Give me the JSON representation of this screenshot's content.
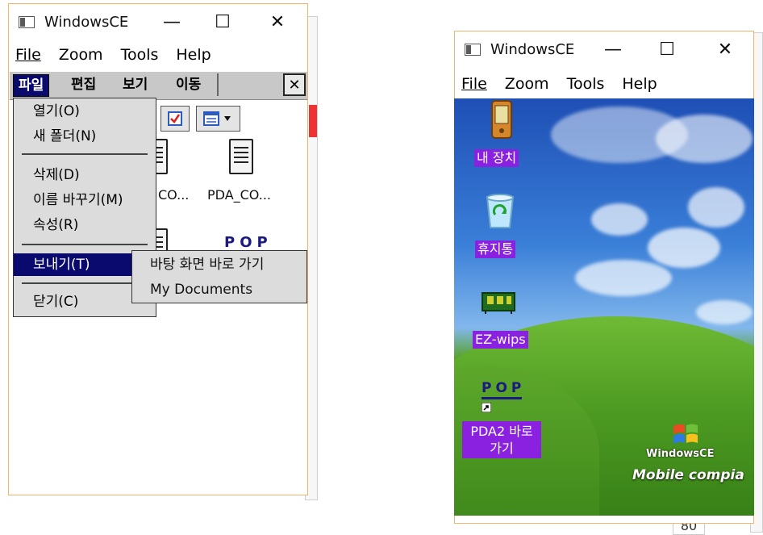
{
  "left_window": {
    "title": "WindowsCE",
    "controls": {
      "minimize": "—",
      "maximize": "☐",
      "close": "✕"
    },
    "menu": {
      "file": "File",
      "zoom": "Zoom",
      "tools": "Tools",
      "help": "Help"
    },
    "ce_menu": {
      "file": "파일",
      "edit": "편집",
      "view": "보기",
      "go": "이동",
      "close": "✕"
    },
    "dropdown": {
      "open": "열기(O)",
      "new_folder": "새 폴더(N)",
      "delete": "삭제(D)",
      "rename": "이름 바꾸기(M)",
      "properties": "속성(R)",
      "send_to": "보내기(T)",
      "close": "닫기(C)"
    },
    "submenu": {
      "desktop_shortcut": "바탕 화면 바로 가기",
      "my_documents": "My Documents"
    },
    "files": [
      {
        "label": "CO..."
      },
      {
        "label": "PDA_CO..."
      }
    ],
    "pop_text": "POP"
  },
  "right_window": {
    "title": "WindowsCE",
    "controls": {
      "minimize": "—",
      "maximize": "☐",
      "close": "✕"
    },
    "menu": {
      "file": "File",
      "zoom": "Zoom",
      "tools": "Tools",
      "help": "Help"
    },
    "desktop_icons": [
      {
        "label": "내 장치",
        "icon": "pda-device-icon"
      },
      {
        "label": "휴지통",
        "icon": "recycle-bin-icon"
      },
      {
        "label": "EZ-wips",
        "icon": "ez-wips-board-icon"
      },
      {
        "label": "PDA2 바로 가기",
        "icon": "pop-shortcut-icon",
        "pop_text": "POP"
      }
    ],
    "branding": {
      "logo_text": "WindowsCE",
      "product": "Mobile compia"
    }
  },
  "background_fragments": {
    "bottom_right_number": "80"
  }
}
